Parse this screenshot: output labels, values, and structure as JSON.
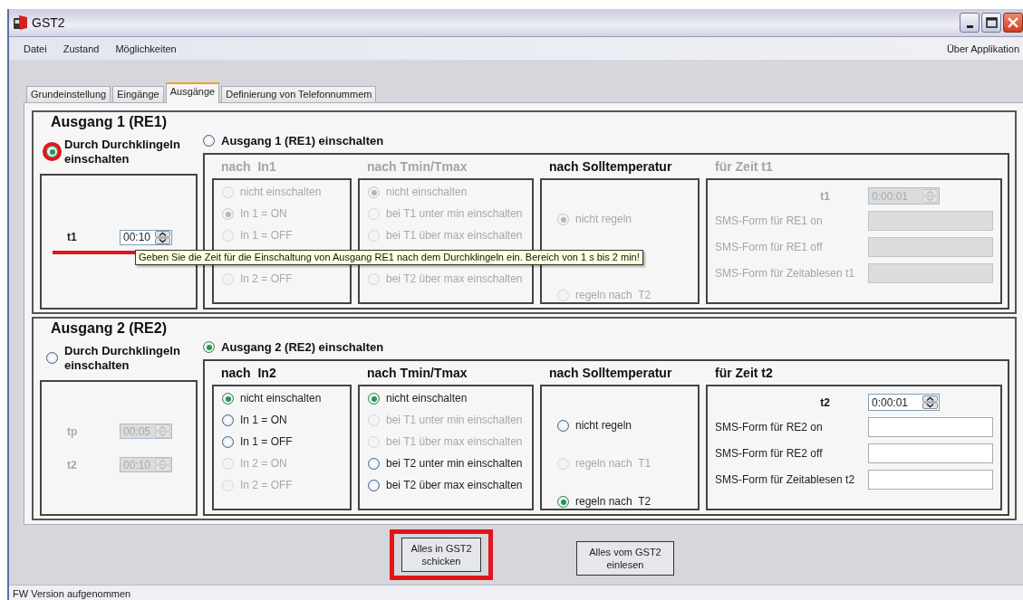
{
  "window": {
    "title": "GST2"
  },
  "menu": {
    "items": [
      "Datei",
      "Zustand",
      "Möglichkeiten"
    ],
    "right_item": "Über Applikation"
  },
  "tabs": [
    {
      "label": "Grundeinstellung",
      "selected": false
    },
    {
      "label": "Eingänge",
      "selected": false
    },
    {
      "label": "Ausgänge",
      "selected": true
    },
    {
      "label": "Definierung von Telefonnummem",
      "selected": false
    }
  ],
  "outputs": [
    {
      "title": "Ausgang 1 (RE1)",
      "ring_option": {
        "label": "Durch Durchklingeln einschalten",
        "selected": true,
        "highlighted": true
      },
      "direct_option": {
        "label": "Ausgang 1 (RE1) einschalten",
        "selected": false
      },
      "ring_fields": [
        {
          "label": "t1",
          "value": "00:10",
          "disabled": false,
          "underlined": true
        }
      ],
      "groups": [
        {
          "kind": "options",
          "title": "nach  In1",
          "disabled": true,
          "options": [
            {
              "kind": "radio",
              "label": "nicht einschalten",
              "selected": false,
              "disabled": true
            },
            {
              "kind": "radio",
              "label": "In 1 = ON",
              "selected": true,
              "disabled": true
            },
            {
              "kind": "radio",
              "label": "In 1 = OFF",
              "selected": false,
              "disabled": true
            },
            {
              "kind": "covered"
            },
            {
              "kind": "radio",
              "label": "In 2 = OFF",
              "selected": false,
              "disabled": true
            }
          ]
        },
        {
          "kind": "options",
          "title": "nach Tmin/Tmax",
          "disabled": true,
          "options": [
            {
              "kind": "radio",
              "label": "nicht einschalten",
              "selected": true,
              "disabled": true
            },
            {
              "kind": "radio",
              "label": "bei T1 unter min einschalten",
              "selected": false,
              "disabled": true
            },
            {
              "kind": "radio",
              "label": "bei T1 über max einschalten",
              "selected": false,
              "disabled": true
            },
            {
              "kind": "covered"
            },
            {
              "kind": "radio",
              "label": "bei T2 über max einschalten",
              "selected": false,
              "disabled": true
            }
          ]
        },
        {
          "kind": "centered",
          "title": "nach Solltemperatur",
          "disabled": false,
          "options": [
            {
              "kind": "radio",
              "label": "nicht regeln",
              "selected": true,
              "disabled": true
            },
            {
              "kind": "covered"
            },
            {
              "kind": "radio",
              "label": "regeln nach  T2",
              "selected": false,
              "disabled": true
            }
          ]
        },
        {
          "kind": "time",
          "title": "für Zeit t1",
          "disabled": true,
          "time_label": "t1",
          "time_value": "0:00:01",
          "fields": [
            {
              "label": "SMS-Form für RE1 on"
            },
            {
              "label": "SMS-Form für RE1 off"
            },
            {
              "label": "SMS-Form für Zeitablesen t1"
            }
          ]
        }
      ],
      "tooltip": "Geben Sie die Zeit für die Einschaltung von Ausgang RE1 nach dem Durchklingeln ein. Bereich von 1 s bis 2 min!"
    },
    {
      "title": "Ausgang 2 (RE2)",
      "ring_option": {
        "label": "Durch Durchklingeln einschalten",
        "selected": false,
        "highlighted": false
      },
      "direct_option": {
        "label": "Ausgang 2 (RE2) einschalten",
        "selected": true
      },
      "ring_fields": [
        {
          "label": "tp",
          "value": "00:05",
          "disabled": true,
          "underlined": false
        },
        {
          "label": "t2",
          "value": "00:10",
          "disabled": true,
          "underlined": false
        }
      ],
      "groups": [
        {
          "kind": "options",
          "title": "nach  In2",
          "disabled": false,
          "options": [
            {
              "kind": "radio",
              "label": "nicht einschalten",
              "selected": true,
              "disabled": false
            },
            {
              "kind": "radio",
              "label": "In 1 = ON",
              "selected": false,
              "disabled": false
            },
            {
              "kind": "radio",
              "label": "In 1 = OFF",
              "selected": false,
              "disabled": false
            },
            {
              "kind": "radio",
              "label": "In 2 = ON",
              "selected": false,
              "disabled": true
            },
            {
              "kind": "radio",
              "label": "In 2 = OFF",
              "selected": false,
              "disabled": true
            }
          ]
        },
        {
          "kind": "options",
          "title": "nach Tmin/Tmax",
          "disabled": false,
          "options": [
            {
              "kind": "radio",
              "label": "nicht einschalten",
              "selected": true,
              "disabled": false
            },
            {
              "kind": "radio",
              "label": "bei T1 unter min einschalten",
              "selected": false,
              "disabled": true
            },
            {
              "kind": "radio",
              "label": "bei T1 über max einschalten",
              "selected": false,
              "disabled": true
            },
            {
              "kind": "radio",
              "label": "bei T2 unter min einschalten",
              "selected": false,
              "disabled": false
            },
            {
              "kind": "radio",
              "label": "bei T2 über max einschalten",
              "selected": false,
              "disabled": false
            }
          ]
        },
        {
          "kind": "centered",
          "title": "nach Solltemperatur",
          "disabled": false,
          "options": [
            {
              "kind": "radio",
              "label": "nicht regeln",
              "selected": false,
              "disabled": false
            },
            {
              "kind": "radio",
              "label": "regeln nach  T1",
              "selected": false,
              "disabled": true
            },
            {
              "kind": "radio",
              "label": "regeln nach  T2",
              "selected": true,
              "disabled": false
            }
          ]
        },
        {
          "kind": "time",
          "title": "für Zeit t2",
          "disabled": false,
          "time_label": "t2",
          "time_value": "0:00:01",
          "fields": [
            {
              "label": "SMS-Form für RE2 on"
            },
            {
              "label": "SMS-Form für RE2 off"
            },
            {
              "label": "SMS-Form für Zeitablesen t2"
            }
          ]
        }
      ]
    }
  ],
  "buttons": [
    {
      "label": "Alles in GST2 schicken",
      "highlighted": true
    },
    {
      "label": "Alles vom GST2 einlesen",
      "highlighted": false
    }
  ],
  "status_bar": "FW Version aufgenommen"
}
